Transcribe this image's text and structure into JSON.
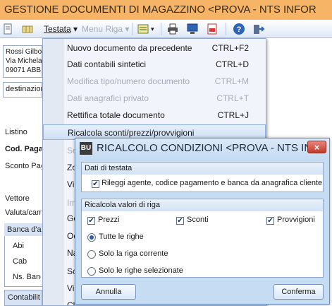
{
  "window": {
    "title": "GESTIONE DOCUMENTI DI MAGAZZINO <PROVA - NTS INFOR"
  },
  "toolbar": {
    "menu_testata": "Testata",
    "menu_riga": "Menu Riga",
    "icons": [
      "document-icon",
      "grid-icon",
      "list-icon",
      "print-icon",
      "monitor-icon",
      "pdf-icon",
      "help-icon",
      "exit-icon"
    ]
  },
  "form": {
    "address_lines": [
      "Rossi Gilbo",
      "Via Michela",
      "09071 ABB"
    ],
    "destination": "destinazion",
    "labels": {
      "listino": "Listino",
      "cod_pag": "Cod. Paga",
      "sconto_pag": "Sconto Pag",
      "vettore": "Vettore",
      "valuta": "Valuta/cam"
    },
    "bank_group": {
      "title": "Banca d'a",
      "rows": [
        "Abi",
        "Cab",
        "Ns. Banc"
      ]
    },
    "accounting_group": {
      "title": "Contabilit"
    }
  },
  "menu": {
    "items": [
      {
        "label": "Nuovo documento da precedente",
        "shortcut": "CTRL+F2",
        "disabled": false
      },
      {
        "label": "Dati contabili sintetici",
        "shortcut": "CTRL+D",
        "disabled": false
      },
      {
        "label": "Modifica tipo/numero documento",
        "shortcut": "CTRL+M",
        "disabled": true
      },
      {
        "label": "Dati anagrafici privato",
        "shortcut": "CTRL+T",
        "disabled": true
      },
      {
        "label": "Rettifica totale documento",
        "shortcut": "CTRL+J",
        "disabled": false
      },
      {
        "label": "Ricalcola sconti/prezzi/provvigioni",
        "shortcut": "",
        "disabled": false
      }
    ],
    "partial_items": [
      "Se",
      "Zo",
      "Vi",
      "Im",
      "Ge",
      "Oc",
      "Na",
      "Sc",
      "Vi",
      "Cl"
    ]
  },
  "dialog": {
    "icon_text": "BU",
    "title": "RICALCOLO CONDIZIONI <PROVA - NTS IN...",
    "close": "×",
    "group1": {
      "title": "Dati di testata",
      "checkbox": "Rileggi agente, codice pagamento e banca da anagrafica cliente"
    },
    "group2": {
      "title": "Ricalcola valori di riga",
      "checkboxes": [
        "Prezzi",
        "Sconti",
        "Provvigioni"
      ],
      "radios": [
        "Tutte le righe",
        "Solo la riga corrente",
        "Solo le righe selezionate"
      ],
      "selected_radio": "Tutte le righe"
    },
    "buttons": {
      "cancel": "Annulla",
      "confirm": "Conferma"
    }
  },
  "check_mark": "✔"
}
